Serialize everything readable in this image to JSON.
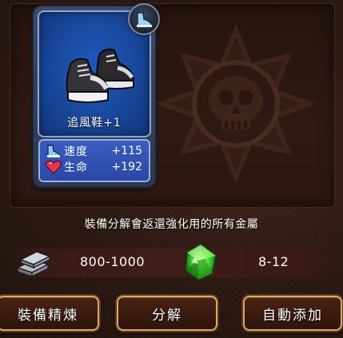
{
  "item": {
    "name": "追風鞋+1",
    "type_icon": "boots-category-icon",
    "art_icon": "sneakers-icon",
    "stats": [
      {
        "icon": "speed-boot-icon",
        "label": "速度",
        "value": "+115"
      },
      {
        "icon": "heart-icon",
        "label": "生命",
        "value": "+192"
      }
    ]
  },
  "description": "裝備分解會返還強化用的所有金屬",
  "returns": {
    "metal": {
      "icon": "metal-ingot-icon",
      "amount": "800-1000"
    },
    "gem": {
      "icon": "green-crystal-icon",
      "amount": "8-12"
    }
  },
  "buttons": {
    "refine": "裝備精煉",
    "decompose": "分解",
    "auto_add": "自動添加"
  },
  "colors": {
    "card_blue": "#1a4ba0",
    "stats_blue": "#2a49a6",
    "button_border": "#d8a86a",
    "button_fill": "#3b1b0f",
    "gem_green": "#3bd12b"
  }
}
